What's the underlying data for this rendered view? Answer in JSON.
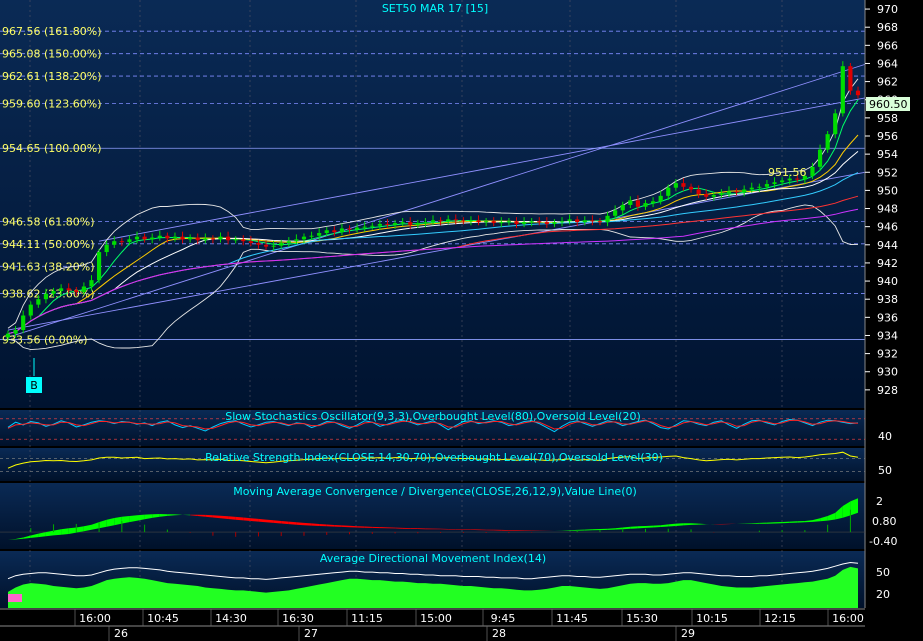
{
  "colors": {
    "background_top": "#0a2a55",
    "background_bottom": "#001330",
    "candle_up": "#00dd00",
    "candle_down": "#dd0000",
    "fib_label": "#ffff66",
    "price_badge_bg": "#d9ffd9",
    "band": "#e6e6e6",
    "stoch_k": "#00ccff",
    "stoch_d": "#ff2222",
    "rsi": "#ffff00",
    "macd_pos": "#00ff00",
    "macd_neg": "#ff0000",
    "adx_area": "#22ff22",
    "adx_line": "#ffffff",
    "title": "#00ffff",
    "axis_text": "#ffffff"
  },
  "chart_data": [
    {
      "type": "candlestick",
      "title": "SET50 MAR 17   [15]",
      "ylim": [
        926,
        971
      ],
      "y_ticks": [
        928,
        930,
        932,
        934,
        936,
        938,
        940,
        942,
        944,
        946,
        948,
        950,
        952,
        954,
        956,
        958,
        960,
        962,
        964,
        966,
        968,
        970
      ],
      "last_price": "960.50",
      "annotation": "951.56",
      "marker": "B",
      "fib_levels": [
        {
          "label": "967.56 (161.80%)",
          "value": 967.56
        },
        {
          "label": "965.08 (150.00%)",
          "value": 965.08
        },
        {
          "label": "962.61 (138.20%)",
          "value": 962.61
        },
        {
          "label": "959.60 (123.60%)",
          "value": 959.6
        },
        {
          "label": "954.65 (100.00%)",
          "value": 954.65
        },
        {
          "label": "946.58 (61.80%)",
          "value": 946.58
        },
        {
          "label": "944.11 (50.00%)",
          "value": 944.11
        },
        {
          "label": "941.63 (38.20%)",
          "value": 941.63
        },
        {
          "label": "938.62 (23.60%)",
          "value": 938.62
        },
        {
          "label": "933.56 (0.00%)",
          "value": 933.56
        }
      ],
      "close": [
        934.2,
        934.6,
        936.2,
        937.4,
        938.0,
        938.6,
        938.9,
        939.2,
        939.0,
        938.8,
        939.4,
        940.1,
        943.2,
        944.0,
        944.4,
        944.3,
        944.6,
        944.9,
        944.6,
        944.8,
        945.0,
        944.7,
        944.9,
        944.6,
        944.8,
        944.5,
        944.7,
        944.6,
        944.9,
        944.5,
        944.6,
        944.4,
        944.2,
        944.0,
        943.8,
        943.9,
        944.2,
        944.4,
        944.6,
        944.9,
        945.0,
        945.3,
        945.6,
        945.4,
        945.8,
        945.7,
        945.9,
        946.0,
        946.1,
        946.3,
        946.2,
        946.4,
        946.5,
        946.2,
        946.4,
        946.5,
        946.7,
        946.6,
        946.8,
        946.7,
        946.6,
        946.7,
        946.5,
        946.6,
        946.4,
        946.5,
        946.6,
        946.3,
        946.5,
        946.6,
        946.5,
        946.3,
        946.5,
        946.6,
        946.8,
        946.5,
        946.7,
        946.6,
        946.5,
        947.2,
        947.8,
        948.4,
        948.9,
        948.2,
        948.6,
        948.8,
        949.4,
        950.3,
        950.8,
        950.4,
        950.1,
        949.6,
        949.3,
        949.5,
        949.7,
        949.9,
        949.8,
        950.1,
        950.3,
        950.4,
        950.7,
        950.9,
        951.1,
        951.3,
        951.2,
        951.6,
        952.6,
        954.5,
        956.2,
        958.5,
        963.7,
        961.0,
        960.5
      ]
    },
    {
      "type": "line",
      "title": "Slow Stochastics Oscillator(9,3,3),Overbought Level(80),Oversold Level(20)",
      "ylim": [
        0,
        100
      ],
      "y_ticks": [
        40
      ],
      "series": [
        {
          "name": "%K",
          "values": [
            55,
            70,
            62,
            72,
            68,
            58,
            64,
            74,
            68,
            56,
            62,
            70,
            74,
            72,
            66,
            72,
            70,
            64,
            68,
            60,
            70,
            74,
            62,
            54,
            60,
            52,
            44,
            56,
            66,
            72,
            74,
            64,
            56,
            62,
            70,
            72,
            66,
            60,
            68,
            66,
            54,
            62,
            72,
            70,
            60,
            52,
            62,
            74,
            70,
            58,
            64,
            72,
            76,
            70,
            62,
            68,
            74,
            62,
            48,
            60,
            72,
            74,
            66,
            70,
            74,
            70,
            60,
            64,
            72,
            74,
            66,
            54,
            42,
            58,
            70,
            74,
            66,
            58,
            66,
            74,
            70,
            60,
            66,
            72,
            76,
            66,
            54,
            50,
            62,
            74,
            72,
            64,
            60,
            70,
            74,
            62,
            52,
            64,
            74,
            76,
            68,
            62,
            72,
            78,
            76,
            68,
            60,
            70,
            76,
            74,
            70,
            66,
            68
          ]
        },
        {
          "name": "%D",
          "values": [
            52,
            62,
            64,
            68,
            66,
            62,
            62,
            70,
            69,
            62,
            60,
            66,
            72,
            72,
            68,
            70,
            70,
            66,
            66,
            64,
            66,
            71,
            68,
            60,
            58,
            56,
            50,
            52,
            60,
            68,
            72,
            69,
            62,
            60,
            66,
            70,
            68,
            62,
            66,
            66,
            60,
            60,
            68,
            70,
            64,
            56,
            58,
            68,
            70,
            64,
            62,
            68,
            73,
            72,
            66,
            66,
            70,
            66,
            56,
            56,
            66,
            72,
            69,
            68,
            72,
            72,
            65,
            62,
            68,
            72,
            70,
            60,
            50,
            52,
            64,
            71,
            70,
            62,
            63,
            70,
            71,
            65,
            64,
            69,
            74,
            70,
            60,
            54,
            58,
            68,
            72,
            68,
            62,
            66,
            71,
            67,
            58,
            60,
            70,
            74,
            71,
            65,
            68,
            75,
            76,
            71,
            64,
            66,
            72,
            74,
            72,
            68,
            67
          ]
        }
      ]
    },
    {
      "type": "line",
      "title": "Relative Strength Index(CLOSE,14,30,70),Overbought Level(70),Oversold Level(30)",
      "ylim": [
        0,
        100
      ],
      "y_ticks": [
        50
      ],
      "series": [
        {
          "name": "RSI",
          "values": [
            40,
            50,
            56,
            60,
            62,
            64,
            63,
            64,
            62,
            61,
            63,
            66,
            72,
            74,
            74,
            72,
            73,
            74,
            70,
            71,
            72,
            69,
            70,
            68,
            69,
            66,
            67,
            66,
            68,
            64,
            65,
            63,
            61,
            59,
            57,
            59,
            62,
            63,
            65,
            67,
            68,
            70,
            72,
            69,
            72,
            70,
            71,
            72,
            72,
            73,
            71,
            73,
            73,
            70,
            71,
            72,
            73,
            71,
            73,
            71,
            70,
            71,
            68,
            69,
            66,
            67,
            68,
            65,
            67,
            68,
            66,
            64,
            66,
            67,
            69,
            65,
            67,
            66,
            64,
            70,
            73,
            75,
            76,
            70,
            72,
            73,
            75,
            77,
            78,
            73,
            70,
            66,
            63,
            65,
            67,
            68,
            66,
            68,
            70,
            70,
            72,
            73,
            74,
            75,
            73,
            75,
            78,
            82,
            84,
            86,
            90,
            78,
            74
          ]
        }
      ]
    },
    {
      "type": "area",
      "title": "Moving Average Convergence / Divergence(CLOSE,26,12,9),Value Line(0)",
      "ylim": [
        -1.1,
        3.0
      ],
      "y_ticks": [
        2,
        0.8,
        -0.4
      ],
      "y_tick_labels": [
        "2",
        "0.80",
        "-0.40"
      ],
      "series": [
        {
          "name": "MACD",
          "values": [
            -0.5,
            -0.45,
            -0.35,
            -0.22,
            -0.1,
            0.0,
            0.1,
            0.18,
            0.25,
            0.3,
            0.38,
            0.48,
            0.65,
            0.8,
            0.92,
            1.0,
            1.05,
            1.1,
            1.14,
            1.16,
            1.18,
            1.16,
            1.15,
            1.12,
            1.1,
            1.05,
            1.0,
            0.95,
            0.9,
            0.85,
            0.8,
            0.76,
            0.72,
            0.68,
            0.64,
            0.6,
            0.56,
            0.52,
            0.48,
            0.45,
            0.42,
            0.4,
            0.38,
            0.36,
            0.34,
            0.32,
            0.3,
            0.28,
            0.27,
            0.26,
            0.25,
            0.24,
            0.22,
            0.21,
            0.2,
            0.19,
            0.18,
            0.18,
            0.17,
            0.16,
            0.15,
            0.14,
            0.13,
            0.12,
            0.11,
            0.1,
            0.09,
            0.08,
            0.08,
            0.08,
            0.08,
            0.08,
            0.09,
            0.1,
            0.12,
            0.14,
            0.16,
            0.18,
            0.2,
            0.22,
            0.25,
            0.3,
            0.35,
            0.38,
            0.4,
            0.42,
            0.45,
            0.5,
            0.55,
            0.58,
            0.58,
            0.55,
            0.52,
            0.5,
            0.5,
            0.52,
            0.54,
            0.56,
            0.58,
            0.6,
            0.62,
            0.64,
            0.66,
            0.68,
            0.7,
            0.72,
            0.78,
            0.9,
            1.05,
            1.25,
            1.7,
            2.0,
            2.2
          ]
        },
        {
          "name": "Value Line",
          "values": [
            0
          ]
        }
      ]
    },
    {
      "type": "area",
      "title": "Average Directional Movement Index(14)",
      "ylim": [
        0,
        75
      ],
      "y_ticks": [
        50,
        20
      ],
      "series": [
        {
          "name": "ADX",
          "values": [
            22,
            28,
            32,
            34,
            33,
            32,
            30,
            29,
            28,
            27,
            28,
            30,
            34,
            38,
            40,
            41,
            42,
            41,
            40,
            38,
            36,
            34,
            33,
            32,
            31,
            30,
            28,
            27,
            26,
            25,
            24,
            24,
            23,
            22,
            21,
            22,
            23,
            24,
            26,
            28,
            30,
            32,
            34,
            36,
            38,
            40,
            40,
            39,
            38,
            38,
            37,
            36,
            36,
            35,
            34,
            34,
            33,
            33,
            32,
            31,
            30,
            30,
            29,
            28,
            27,
            27,
            26,
            25,
            24,
            24,
            25,
            26,
            28,
            30,
            30,
            29,
            28,
            27,
            26,
            27,
            29,
            31,
            33,
            34,
            34,
            33,
            33,
            34,
            36,
            38,
            38,
            36,
            34,
            32,
            30,
            29,
            28,
            28,
            28,
            29,
            30,
            31,
            32,
            33,
            34,
            35,
            36,
            38,
            40,
            44,
            52,
            56,
            54
          ]
        },
        {
          "name": "Upper",
          "values": [
            40,
            44,
            46,
            47,
            48,
            48,
            47,
            46,
            45,
            44,
            44,
            45,
            48,
            51,
            53,
            54,
            55,
            55,
            54,
            53,
            52,
            50,
            49,
            48,
            47,
            46,
            45,
            44,
            43,
            42,
            41,
            41,
            40,
            40,
            39,
            40,
            41,
            42,
            43,
            44,
            45,
            46,
            47,
            48,
            49,
            50,
            50,
            49,
            49,
            48,
            48,
            47,
            47,
            46,
            46,
            45,
            45,
            44,
            44,
            44,
            43,
            43,
            43,
            42,
            42,
            41,
            41,
            41,
            40,
            40,
            41,
            42,
            43,
            44,
            44,
            43,
            43,
            42,
            42,
            43,
            44,
            45,
            46,
            46,
            46,
            45,
            45,
            46,
            47,
            48,
            48,
            47,
            46,
            45,
            44,
            44,
            43,
            43,
            43,
            44,
            44,
            45,
            46,
            47,
            48,
            49,
            50,
            52,
            54,
            57,
            60,
            62,
            61
          ]
        }
      ]
    }
  ],
  "time_axis": {
    "time_labels": [
      "16:00",
      "10:45",
      "14:30",
      "16:30",
      "11:15",
      "15:00",
      "9:45",
      "11:45",
      "15:30",
      "10:15",
      "12:15",
      "16:00"
    ],
    "day_labels": [
      "26",
      "27",
      "28",
      "29"
    ]
  }
}
